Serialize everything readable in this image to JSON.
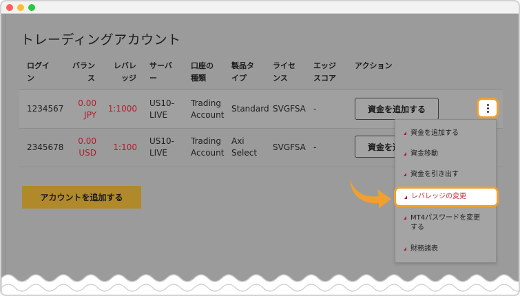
{
  "page": {
    "title": "トレーディングアカウント"
  },
  "colors": {
    "accent": "#f0a030",
    "negative": "#b51a2c",
    "primary_button": "#b08a2a"
  },
  "table": {
    "headers": {
      "login": [
        "ログイ",
        "ン"
      ],
      "balance": [
        "バラン",
        "ス"
      ],
      "leverage": [
        "レバレ",
        "ッジ"
      ],
      "server": [
        "サーバ",
        "ー"
      ],
      "account_type": [
        "口座の",
        "種類"
      ],
      "product_type": [
        "製品タ",
        "イプ"
      ],
      "license": [
        "ライセ",
        "ンス"
      ],
      "edge_score": [
        "エッジ",
        "スコア"
      ],
      "action": "アクション"
    },
    "rows": [
      {
        "login": "1234567",
        "balance": [
          "0.00",
          "JPY"
        ],
        "leverage": "1:1000",
        "server": [
          "US10-",
          "LIVE"
        ],
        "account_type": [
          "Trading",
          "Account"
        ],
        "product_type": "Standard",
        "license": "SVGFSA",
        "edge_score": "-",
        "action_label": "資金を追加する"
      },
      {
        "login": "2345678",
        "balance": [
          "0.00",
          "USD"
        ],
        "leverage": "1:100",
        "server": [
          "US10-",
          "LIVE"
        ],
        "account_type": [
          "Trading",
          "Account"
        ],
        "product_type": [
          "Axi",
          "Select"
        ],
        "license": "SVGFSA",
        "edge_score": "-",
        "action_label": "資金を追加する"
      }
    ]
  },
  "add_account_label": "アカウントを追加する",
  "menu": {
    "items": [
      "資金を追加する",
      "資金移動",
      "資金を引き出す",
      "レバレッジの変更",
      [
        "MT4パスワードを変更",
        "する"
      ],
      "財務諸表"
    ],
    "highlighted_index": 3
  },
  "icons": {
    "more": "kebab-vertical-icon",
    "pointer": "curved-arrow-icon"
  }
}
